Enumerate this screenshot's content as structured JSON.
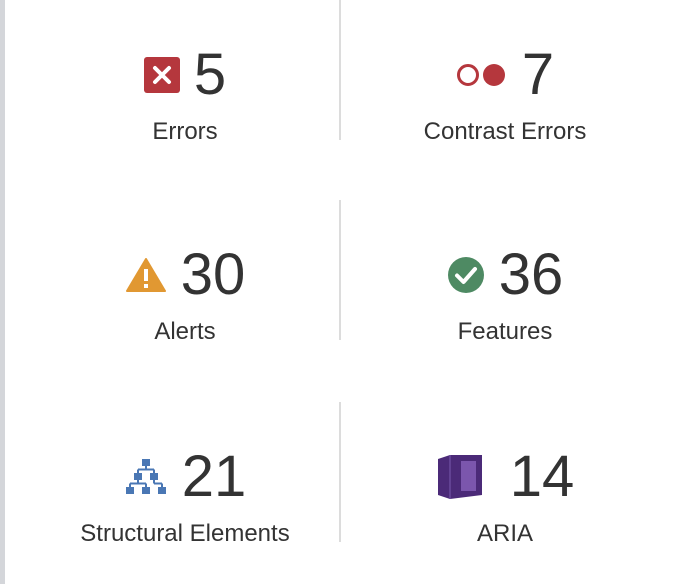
{
  "summary": {
    "errors": {
      "count": "5",
      "label": "Errors",
      "icon": "error-x-icon",
      "color": "#b5373d"
    },
    "contrast_errors": {
      "count": "7",
      "label": "Contrast Errors",
      "icon": "contrast-circles-icon",
      "color": "#b5373d"
    },
    "alerts": {
      "count": "30",
      "label": "Alerts",
      "icon": "warning-triangle-icon",
      "color": "#e19832"
    },
    "features": {
      "count": "36",
      "label": "Features",
      "icon": "check-circle-icon",
      "color": "#4e8a63"
    },
    "structural_elements": {
      "count": "21",
      "label": "Structural Elements",
      "icon": "hierarchy-icon",
      "color": "#4a77b4"
    },
    "aria": {
      "count": "14",
      "label": "ARIA",
      "icon": "aria-cube-icon",
      "color": "#4b2a78"
    }
  }
}
